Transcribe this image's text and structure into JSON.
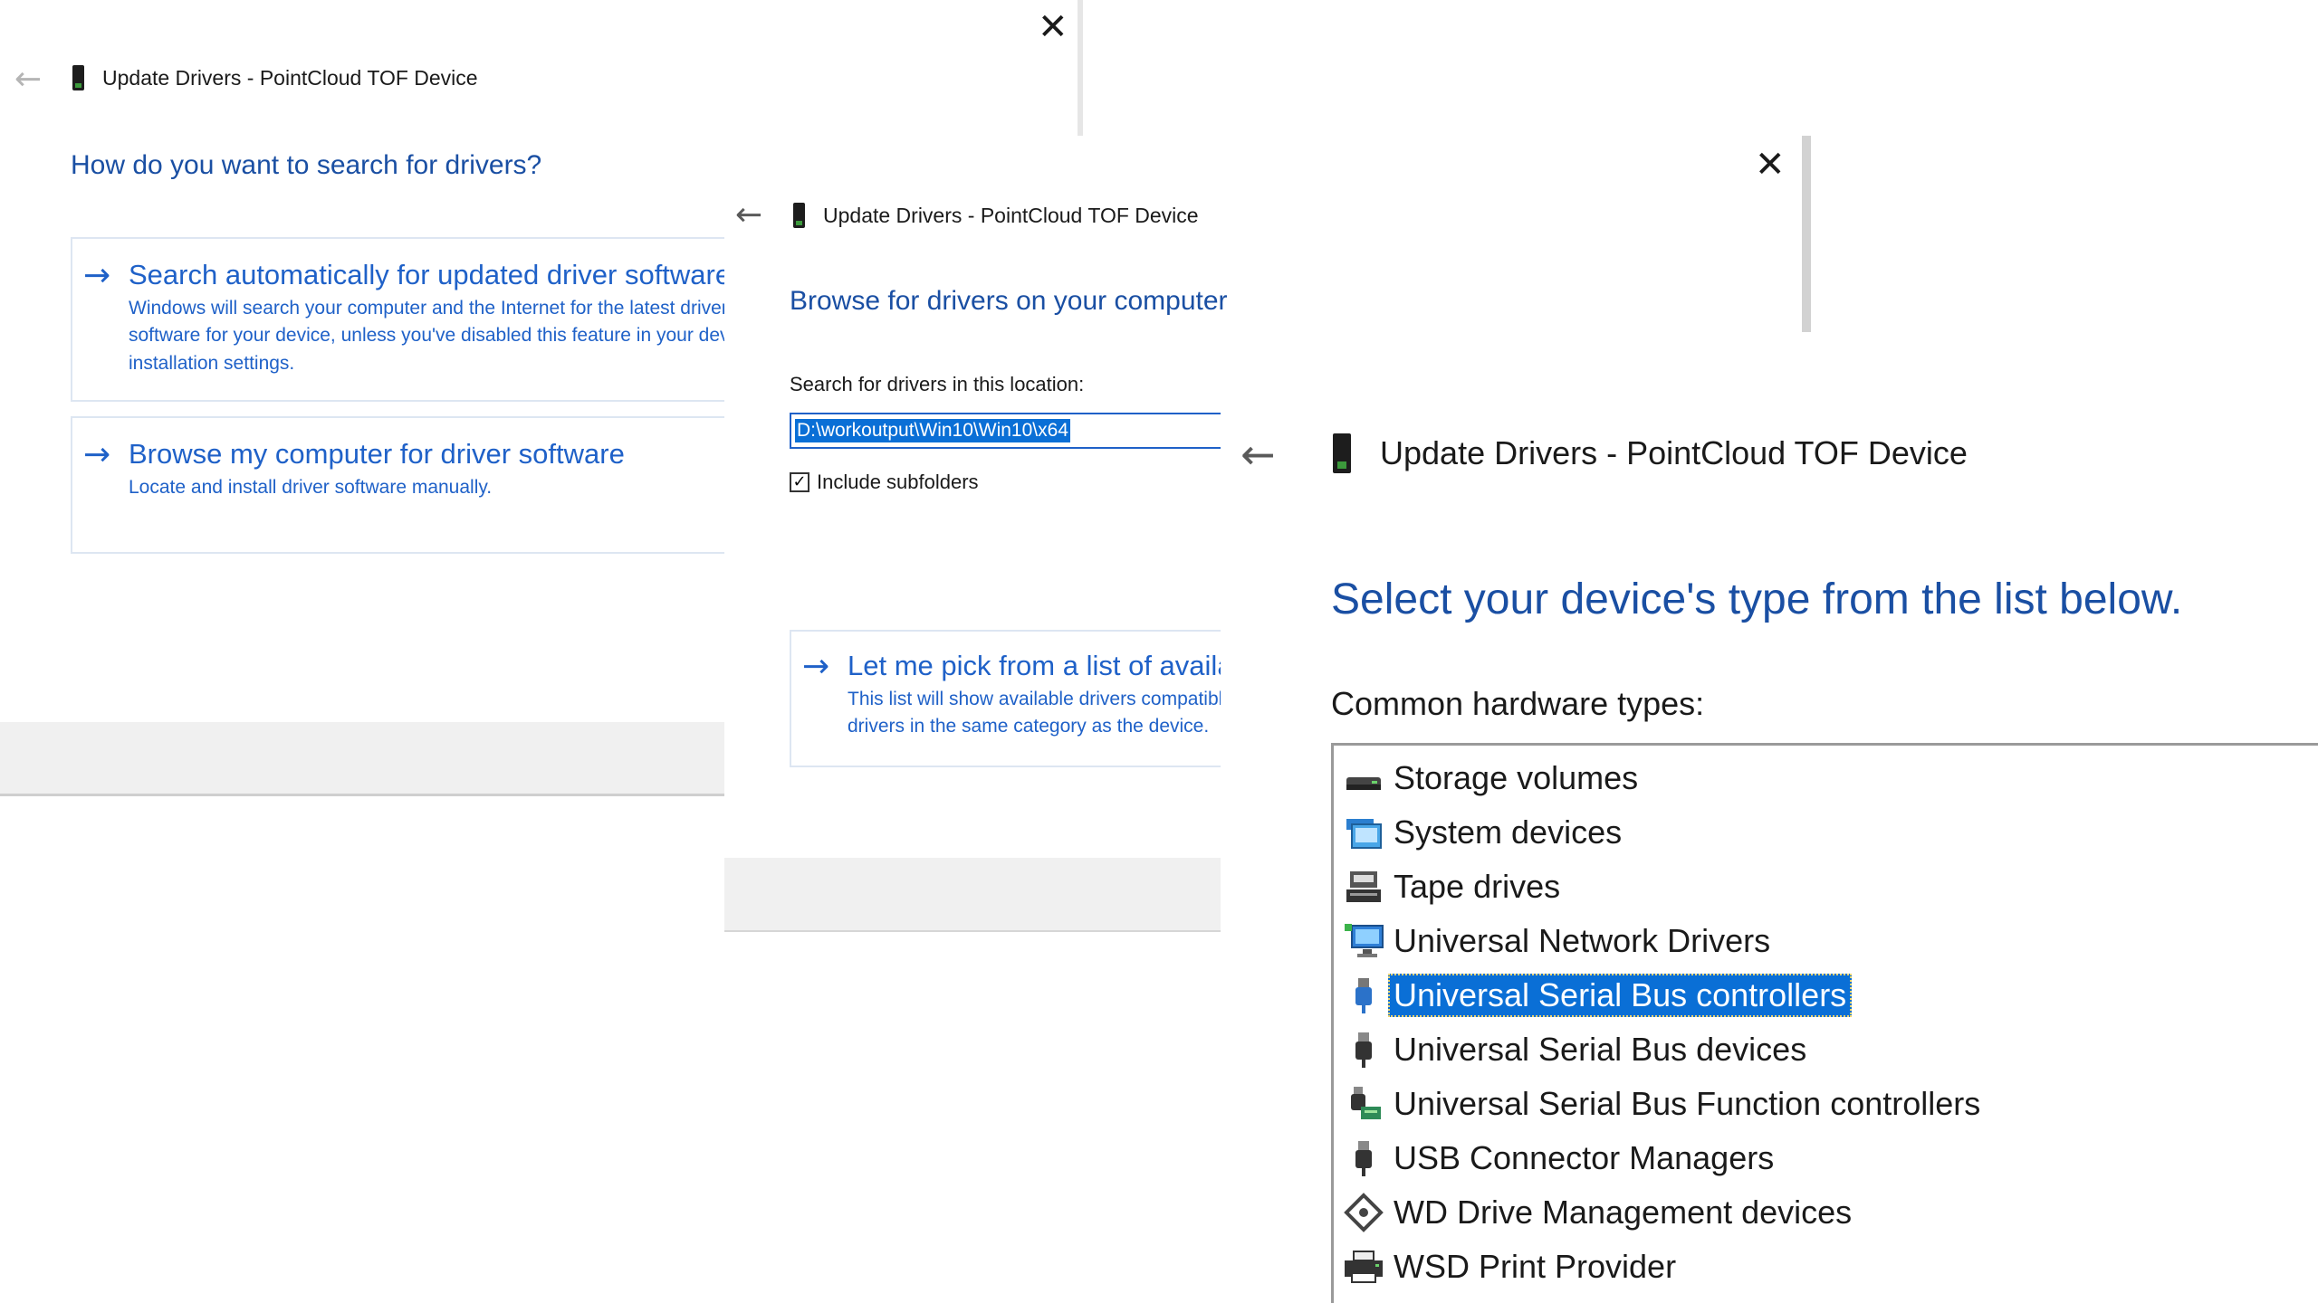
{
  "dialog1": {
    "title": "Update Drivers - PointCloud TOF Device",
    "heading": "How do you want to search for drivers?",
    "options": [
      {
        "title": "Search automatically for updated driver software",
        "desc": "Windows will search your computer and the Internet for the latest driver software for your device, unless you've disabled this feature in your device installation settings."
      },
      {
        "title": "Browse my computer for driver software",
        "desc": "Locate and install driver software manually."
      }
    ]
  },
  "dialog2": {
    "title": "Update Drivers - PointCloud TOF Device",
    "heading": "Browse for drivers on your computer",
    "location_label": "Search for drivers in this location:",
    "location_value": "D:\\workoutput\\Win10\\Win10\\x64",
    "include_subfolders_label": "Include subfolders",
    "include_subfolders_checked": true,
    "pick_option": {
      "title": "Let me pick from a list of available drivers on my computer",
      "desc": "This list will show available drivers compatible with the device, and all drivers in the same category as the device."
    }
  },
  "dialog3": {
    "title": "Update Drivers - PointCloud TOF Device",
    "heading": "Select your device's type from the list below.",
    "list_label": "Common hardware types:",
    "items": [
      {
        "label": "Storage volumes",
        "icon": "storage-volume-icon",
        "selected": false
      },
      {
        "label": "System devices",
        "icon": "system-devices-icon",
        "selected": false
      },
      {
        "label": "Tape drives",
        "icon": "tape-drive-icon",
        "selected": false
      },
      {
        "label": "Universal Network Drivers",
        "icon": "network-monitor-icon",
        "selected": false
      },
      {
        "label": "Universal Serial Bus controllers",
        "icon": "usb-plug-icon",
        "selected": true
      },
      {
        "label": "Universal Serial Bus devices",
        "icon": "usb-plug-icon",
        "selected": false
      },
      {
        "label": "Universal Serial Bus Function controllers",
        "icon": "usb-function-icon",
        "selected": false
      },
      {
        "label": "USB Connector Managers",
        "icon": "usb-plug-icon",
        "selected": false
      },
      {
        "label": "WD Drive Management devices",
        "icon": "wd-drive-icon",
        "selected": false
      },
      {
        "label": "WSD Print Provider",
        "icon": "printer-icon",
        "selected": false
      }
    ]
  },
  "colors": {
    "accent": "#1f61c8",
    "heading": "#1a4fa3",
    "selection": "#0a6fd6"
  }
}
